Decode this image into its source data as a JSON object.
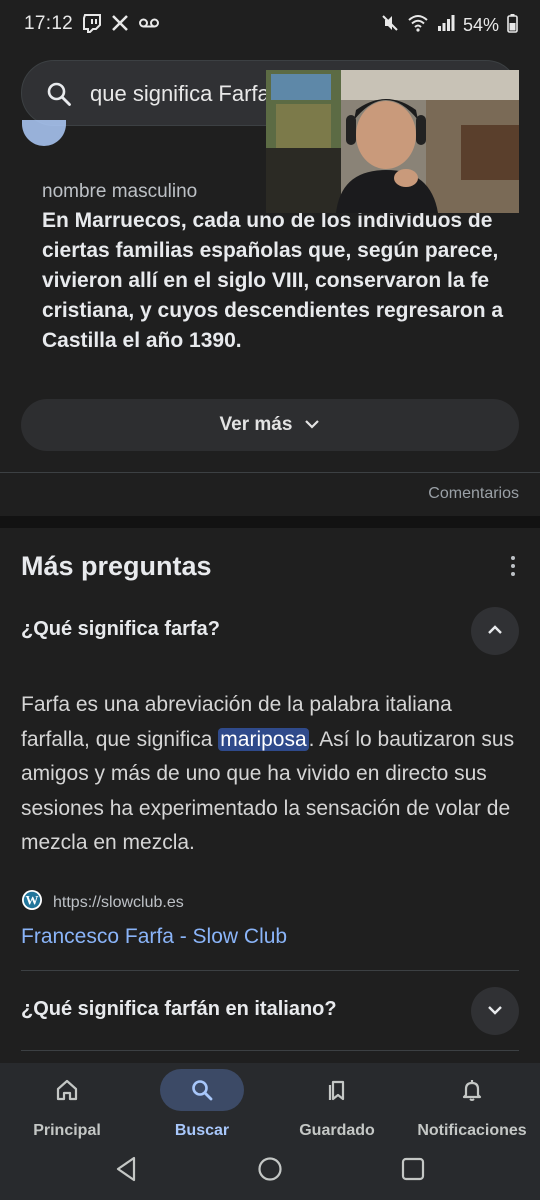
{
  "status_bar": {
    "time": "17:12",
    "left_icons": [
      "twitch-icon",
      "x-icon",
      "voicemail-icon"
    ],
    "right_icons": [
      "mute-icon",
      "wifi-icon",
      "signal-icon",
      "battery-icon"
    ],
    "battery_text": "54%"
  },
  "search": {
    "query": "que significa Farfa"
  },
  "definition": {
    "word_type": "nombre masculino",
    "text": "En Marruecos, cada uno de los individuos de ciertas familias españolas que, según parece, vivieron allí en el siglo VIII, conservaron la fe cristiana, y cuyos descendientes regresaron a Castilla el año 1390.",
    "ver_mas_label": "Ver más",
    "comments_label": "Comentarios"
  },
  "more_questions": {
    "title": "Más preguntas",
    "q1": {
      "question": "¿Qué significa farfa?",
      "answer_before": "Farfa es una abreviación de la palabra italiana farfalla, que significa ",
      "answer_highlight": "mariposa",
      "answer_after": ". Así lo bautizaron sus amigos y más de uno que ha vivido en directo sus sesiones ha experimentado la sensación de volar de mezcla en mezcla.",
      "source_url": "https://slowclub.es",
      "source_title": "Francesco Farfa - Slow Club"
    },
    "q2": {
      "question": "¿Qué significa farfán en italiano?"
    }
  },
  "bottom_nav": {
    "items": [
      {
        "label": "Principal",
        "icon": "home-icon"
      },
      {
        "label": "Buscar",
        "icon": "search-icon",
        "active": true
      },
      {
        "label": "Guardado",
        "icon": "bookmarks-icon"
      },
      {
        "label": "Notificaciones",
        "icon": "bell-icon"
      }
    ]
  },
  "colors": {
    "background": "#1f1f1f",
    "accent": "#8ab4f8",
    "highlight": "#2f4a8b"
  }
}
